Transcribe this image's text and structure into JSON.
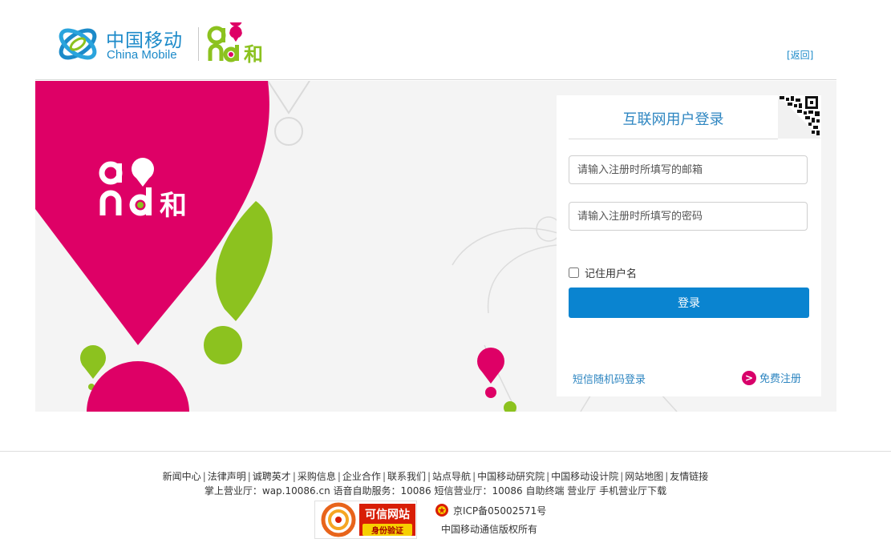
{
  "header": {
    "brand_cn": "中国移动",
    "brand_en": "China Mobile",
    "back_link": "[返回]"
  },
  "banner": {
    "logo_text": "和"
  },
  "login": {
    "title": "互联网用户登录",
    "email_placeholder": "请输入注册时所填写的邮箱",
    "password_placeholder": "请输入注册时所填写的密码",
    "remember_label": "记住用户名",
    "remember_checked": false,
    "submit_label": "登录",
    "sms_login_label": "短信随机码登录",
    "register_icon": ">",
    "register_label": "免费注册"
  },
  "footer": {
    "links": [
      "新闻中心",
      "法律声明",
      "诚聘英才",
      "采购信息",
      "企业合作",
      "联系我们",
      "站点导航",
      "中国移动研究院",
      "中国移动设计院",
      "网站地图",
      "友情链接"
    ],
    "separator": "|",
    "services": "掌上营业厅：wap.10086.cn 语音自助服务：10086 短信营业厅：10086 自助终端 营业厅 手机营业厅下载",
    "trust_badge_main": "可信网站",
    "trust_badge_sub": "身份验证",
    "icp": "京ICP备05002571号",
    "copyright": "中国移动通信版权所有"
  },
  "colors": {
    "brand_blue": "#1c8ac9",
    "and_pink": "#de0066",
    "and_green": "#8cc21f",
    "button_blue": "#0a84d0"
  }
}
